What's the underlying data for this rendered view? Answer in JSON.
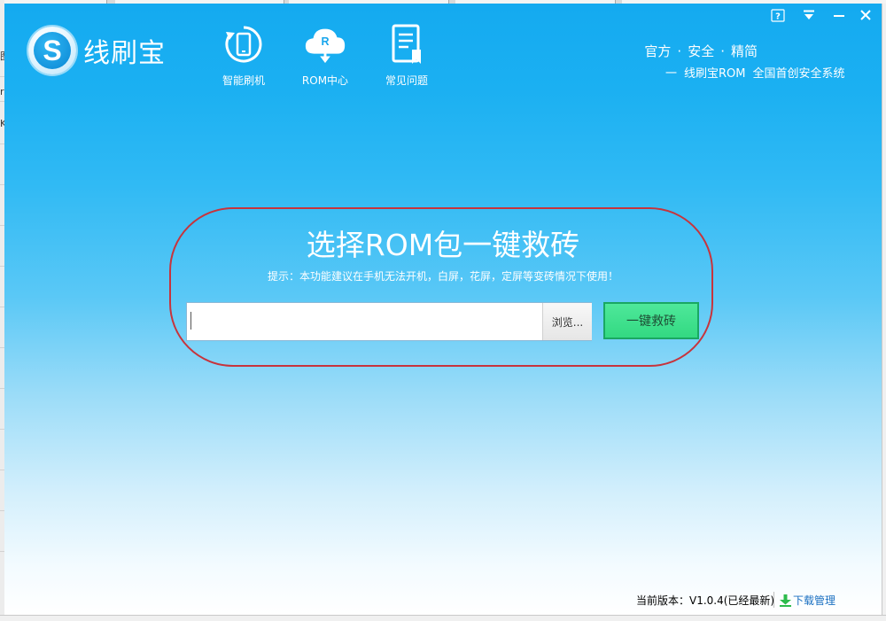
{
  "app": {
    "name": "线刷宝"
  },
  "nav": [
    {
      "label": "智能刷机",
      "icon": "phone-refresh-icon"
    },
    {
      "label": "ROM中心",
      "icon": "cloud-download-icon"
    },
    {
      "label": "常见问题",
      "icon": "faq-document-icon"
    }
  ],
  "window_controls": {
    "help_icon": "help-icon",
    "menu_icon": "dropdown-menu-icon",
    "minimize_icon": "minimize-icon",
    "close_icon": "close-icon"
  },
  "top_links": [
    "官方",
    "安全",
    "精简"
  ],
  "top_links_sep": "·",
  "slogan": {
    "dash": "一",
    "brand": "线刷宝ROM",
    "text": "全国首创安全系统"
  },
  "main": {
    "title": "选择ROM包一键救砖",
    "hint": "提示：本功能建议在手机无法开机，白屏，花屏，定屏等变砖情况下使用！",
    "path_value": "",
    "browse_label": "浏览...",
    "rescue_label": "一键救砖"
  },
  "footer": {
    "version": "当前版本：V1.0.4(已经最新)",
    "download_label": "下载管理"
  },
  "colors": {
    "header_blue": "#14aaf0",
    "rescue_green": "#3ddf8a",
    "panel_outline": "#c7343c",
    "link_blue": "#1a6fc1"
  },
  "background": {
    "edge_glyphs": [
      "图",
      "r",
      "K"
    ]
  }
}
